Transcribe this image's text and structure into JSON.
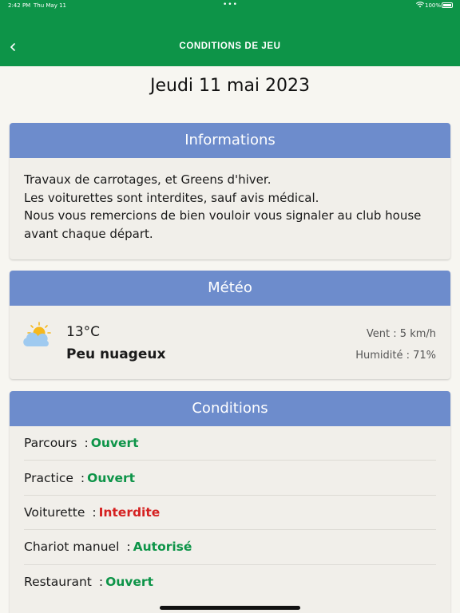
{
  "status_bar": {
    "time": "2:42 PM",
    "date": "Thu May 11",
    "dots": "•••",
    "battery": "100%"
  },
  "header": {
    "title": "CONDITIONS DE JEU",
    "back_icon": "chevron-left-icon",
    "background": "#0d9448"
  },
  "date_heading": "Jeudi 11 mai 2023",
  "informations": {
    "title": "Informations",
    "lines": [
      "Travaux de carrotages, et Greens d'hiver.",
      "Les voiturettes sont interdites, sauf avis médical.",
      "Nous vous remercions de bien vouloir vous signaler au club house avant chaque départ."
    ]
  },
  "meteo": {
    "title": "Météo",
    "icon": "partly-cloudy-icon",
    "temperature": "13°C",
    "sky": "Peu nuageux",
    "wind": "Vent : 5 km/h",
    "humidity": "Humidité : 71%"
  },
  "conditions": {
    "title": "Conditions",
    "separator": ":",
    "items": [
      {
        "label": "Parcours",
        "value": "Ouvert",
        "color": "#0d9448"
      },
      {
        "label": "Practice",
        "value": "Ouvert",
        "color": "#0d9448"
      },
      {
        "label": "Voiturette",
        "value": "Interdite",
        "color": "#d52020"
      },
      {
        "label": "Chariot manuel",
        "value": "Autorisé",
        "color": "#0d9448"
      },
      {
        "label": "Restaurant",
        "value": "Ouvert",
        "color": "#0d9448"
      }
    ]
  },
  "colors": {
    "card_header": "#6d8ccc",
    "page_background": "#f7f6f1"
  }
}
